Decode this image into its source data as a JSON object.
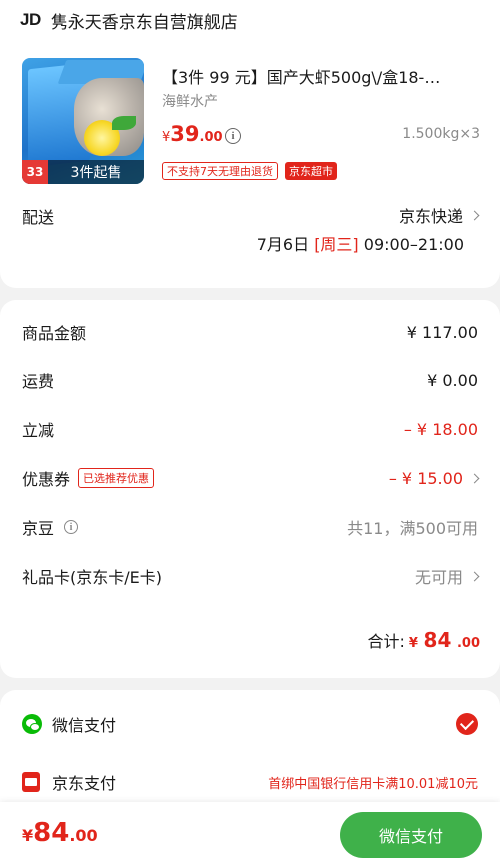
{
  "store": {
    "logo": "JD",
    "name": "隽永天香京东自营旗舰店"
  },
  "product": {
    "title": "【3件 99 元】国产大虾500g\\/盒18-…",
    "category": "海鲜水产",
    "price_currency": "¥",
    "price_int": "39",
    "price_dec": ".00",
    "weight": "1.500kg×3",
    "badge_number": "33",
    "image_caption": "3件起售",
    "tag_no_return": "不支持7天无理由退货",
    "tag_supermarket": "京东超市"
  },
  "delivery": {
    "label": "配送",
    "method": "京东快递",
    "date": "7月6日",
    "weekday": "[周三]",
    "time_range": "09:00–21:00"
  },
  "amounts": {
    "goods_label": "商品金额",
    "goods_value": "¥ 117.00",
    "shipping_label": "运费",
    "shipping_value": "¥ 0.00",
    "discount_label": "立减",
    "discount_value": "– ¥ 18.00",
    "coupon_label": "优惠券",
    "coupon_tag": "已选推荐优惠",
    "coupon_value": "– ¥ 15.00",
    "jingdou_label": "京豆",
    "jingdou_value": "共11，满500可用",
    "giftcard_label": "礼品卡(京东卡/E卡)",
    "giftcard_value": "无可用",
    "total_label": "合计:",
    "total_currency": "¥",
    "total_int": "84",
    "total_dec": ".00"
  },
  "payment": {
    "wechat_label": "微信支付",
    "jdpay_label": "京东支付",
    "jdpay_promo": "首绑中国银行信用卡满10.01减10元"
  },
  "bottom": {
    "currency": "¥",
    "price_int": "84",
    "price_dec": ".00",
    "pay_button": "微信支付"
  },
  "colors": {
    "accent_red": "#e1251b",
    "wechat_green": "#09bb07",
    "pay_button_green": "#3fb14a"
  }
}
